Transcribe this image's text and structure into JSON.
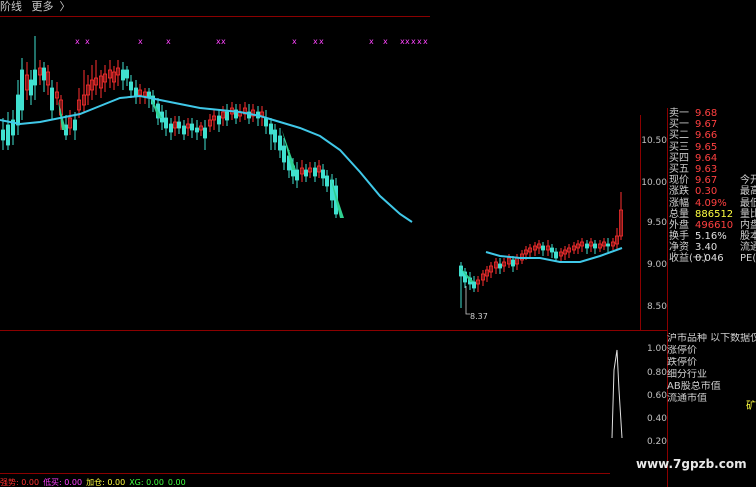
{
  "topbar": {
    "tab_label": "阶线",
    "more_label": "更多",
    "more_arrow": "〉"
  },
  "markers": {
    "symbol": "x",
    "color": "#ff44ff"
  },
  "price_axis": {
    "ticks": [
      "10.50",
      "10.00",
      "9.50",
      "9.00",
      "8.50"
    ]
  },
  "low_label": "8.37",
  "lower_axis": {
    "ticks": [
      "1.00",
      "0.80",
      "0.60",
      "0.40",
      "0.20"
    ]
  },
  "quotes": [
    {
      "k": "卖一",
      "v": "9.68",
      "c": "#ff4040",
      "e": ""
    },
    {
      "k": "买一",
      "v": "9.67",
      "c": "#ff4040",
      "e": ""
    },
    {
      "k": "买二",
      "v": "9.66",
      "c": "#ff4040",
      "e": ""
    },
    {
      "k": "买三",
      "v": "9.65",
      "c": "#ff4040",
      "e": ""
    },
    {
      "k": "买四",
      "v": "9.64",
      "c": "#ff4040",
      "e": ""
    },
    {
      "k": "买五",
      "v": "9.63",
      "c": "#ff4040",
      "e": ""
    },
    {
      "k": "现价",
      "v": "9.67",
      "c": "#ff4040",
      "e": "今开"
    },
    {
      "k": "涨跌",
      "v": "0.30",
      "c": "#ff4040",
      "e": "最高"
    },
    {
      "k": "涨幅",
      "v": "4.09%",
      "c": "#ff4040",
      "e": "最低"
    },
    {
      "k": "总量",
      "v": "886512",
      "c": "#ffff40",
      "e": "量比"
    },
    {
      "k": "外盘",
      "v": "496610",
      "c": "#ff4040",
      "e": "内盘"
    },
    {
      "k": "换手",
      "v": "5.16%",
      "c": "#e0e0e0",
      "e": "股本"
    },
    {
      "k": "净资",
      "v": "3.40",
      "c": "#e0e0e0",
      "e": "流通"
    },
    {
      "k": "收益(一)",
      "v": "0.046",
      "c": "#e0e0e0",
      "e": "PE(动)"
    }
  ],
  "lower_list": {
    "header": "沪市品种  以下数据仅供",
    "items": [
      "涨停价",
      "跌停价",
      "细分行业",
      "AB股总市值",
      "流通市值"
    ],
    "side_char": "矿"
  },
  "bottom_bar": [
    {
      "label": "强势",
      "value": "0.00",
      "color": "#ff3030"
    },
    {
      "label": "低买",
      "value": "0.00",
      "color": "#ff40ff"
    },
    {
      "label": "加仓",
      "value": "0.00",
      "color": "#ffff40"
    },
    {
      "label": "XG",
      "value": "0.00",
      "color": "#40ff40"
    },
    {
      "label": "",
      "value": "0.00",
      "color": "#40ff40"
    }
  ],
  "watermark": "www.7gpzb.com",
  "colors": {
    "up": "#ff3030",
    "down": "#40e0d0",
    "ma": "#40c8e8",
    "grid": "#8b0000",
    "wedge": "#30d090"
  }
}
